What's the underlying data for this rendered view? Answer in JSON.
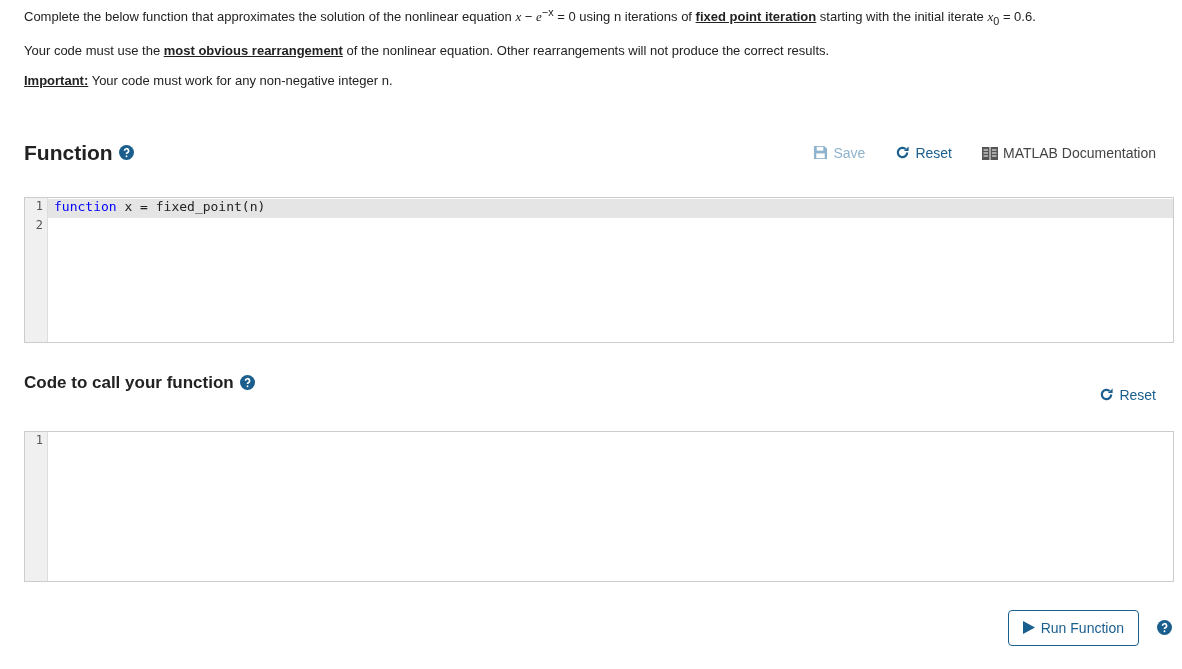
{
  "instructions": [
    "Complete the below function that approximates the solution of the nonlinear equation *x* − *e*$^{−x}$ = 0 using n iterations of **fixed point iteration** starting with the initial iterate *x*$_{0}$ = 0.6.",
    "Your code must use the **most obvious rearrangement** of the nonlinear equation. Other rearrangements will not produce the correct results.",
    "**Important:** Your code must work for any non-negative integer n."
  ],
  "function_section": {
    "title": "Function",
    "actions": [
      {
        "kind": "save",
        "label": "Save",
        "disabled": true
      },
      {
        "kind": "reset",
        "label": "Reset",
        "disabled": false
      },
      {
        "kind": "docs",
        "label": "MATLAB Documentation",
        "disabled": false
      }
    ],
    "editor": {
      "lines": [
        {
          "number": "1",
          "highlighted": true,
          "tokens": [
            {
              "kind": "keyword",
              "text": "function"
            },
            {
              "kind": "plain",
              "text": " x = fixed_point(n)"
            }
          ]
        },
        {
          "number": "2",
          "highlighted": false
        }
      ]
    }
  },
  "call_section": {
    "title": "Code to call your function",
    "actions": [
      {
        "kind": "reset",
        "label": "Reset",
        "disabled": false
      }
    ],
    "editor": {
      "lines": [
        {
          "number": "1",
          "highlighted": false
        }
      ]
    }
  },
  "run_button": {
    "label": "Run Function"
  }
}
